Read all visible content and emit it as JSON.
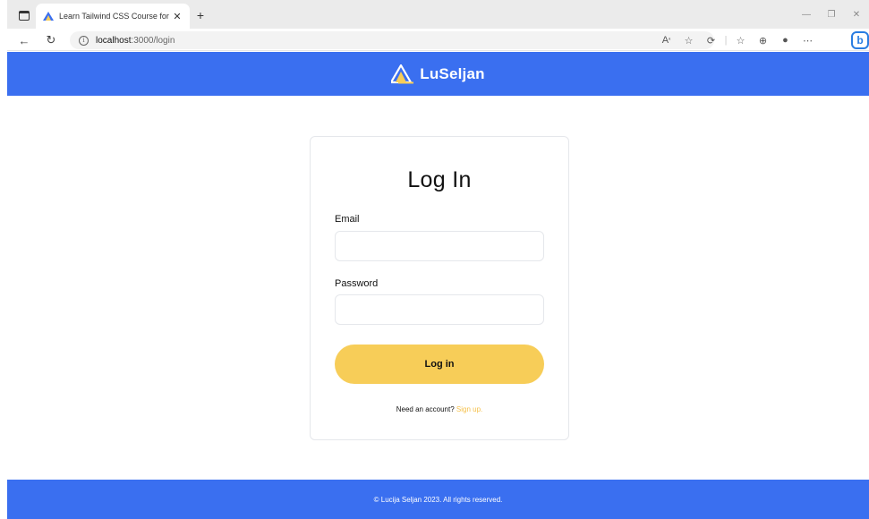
{
  "browser": {
    "tab_title": "Learn Tailwind CSS Course for Be",
    "tab_close": "✕",
    "new_tab": "+",
    "url_host": "localhost",
    "url_path": ":3000/login",
    "icons": [
      "read-aloud-icon",
      "favorite-icon",
      "refresh-page-icon",
      "favorites-bar-icon",
      "collections-icon",
      "profile-icon",
      "more-icon",
      "bing-icon"
    ]
  },
  "site": {
    "brand": "LuSeljan",
    "brand_color": "#3a6ff0",
    "accent_color": "#f7cd58"
  },
  "login": {
    "title": "Log In",
    "email_label": "Email",
    "email_value": "",
    "password_label": "Password",
    "password_value": "",
    "submit_label": "Log in",
    "signup_prompt": "Need an account?",
    "signup_link": "Sign up."
  },
  "footer": {
    "text": "© Lucija Seljan 2023. All rights reserved."
  }
}
